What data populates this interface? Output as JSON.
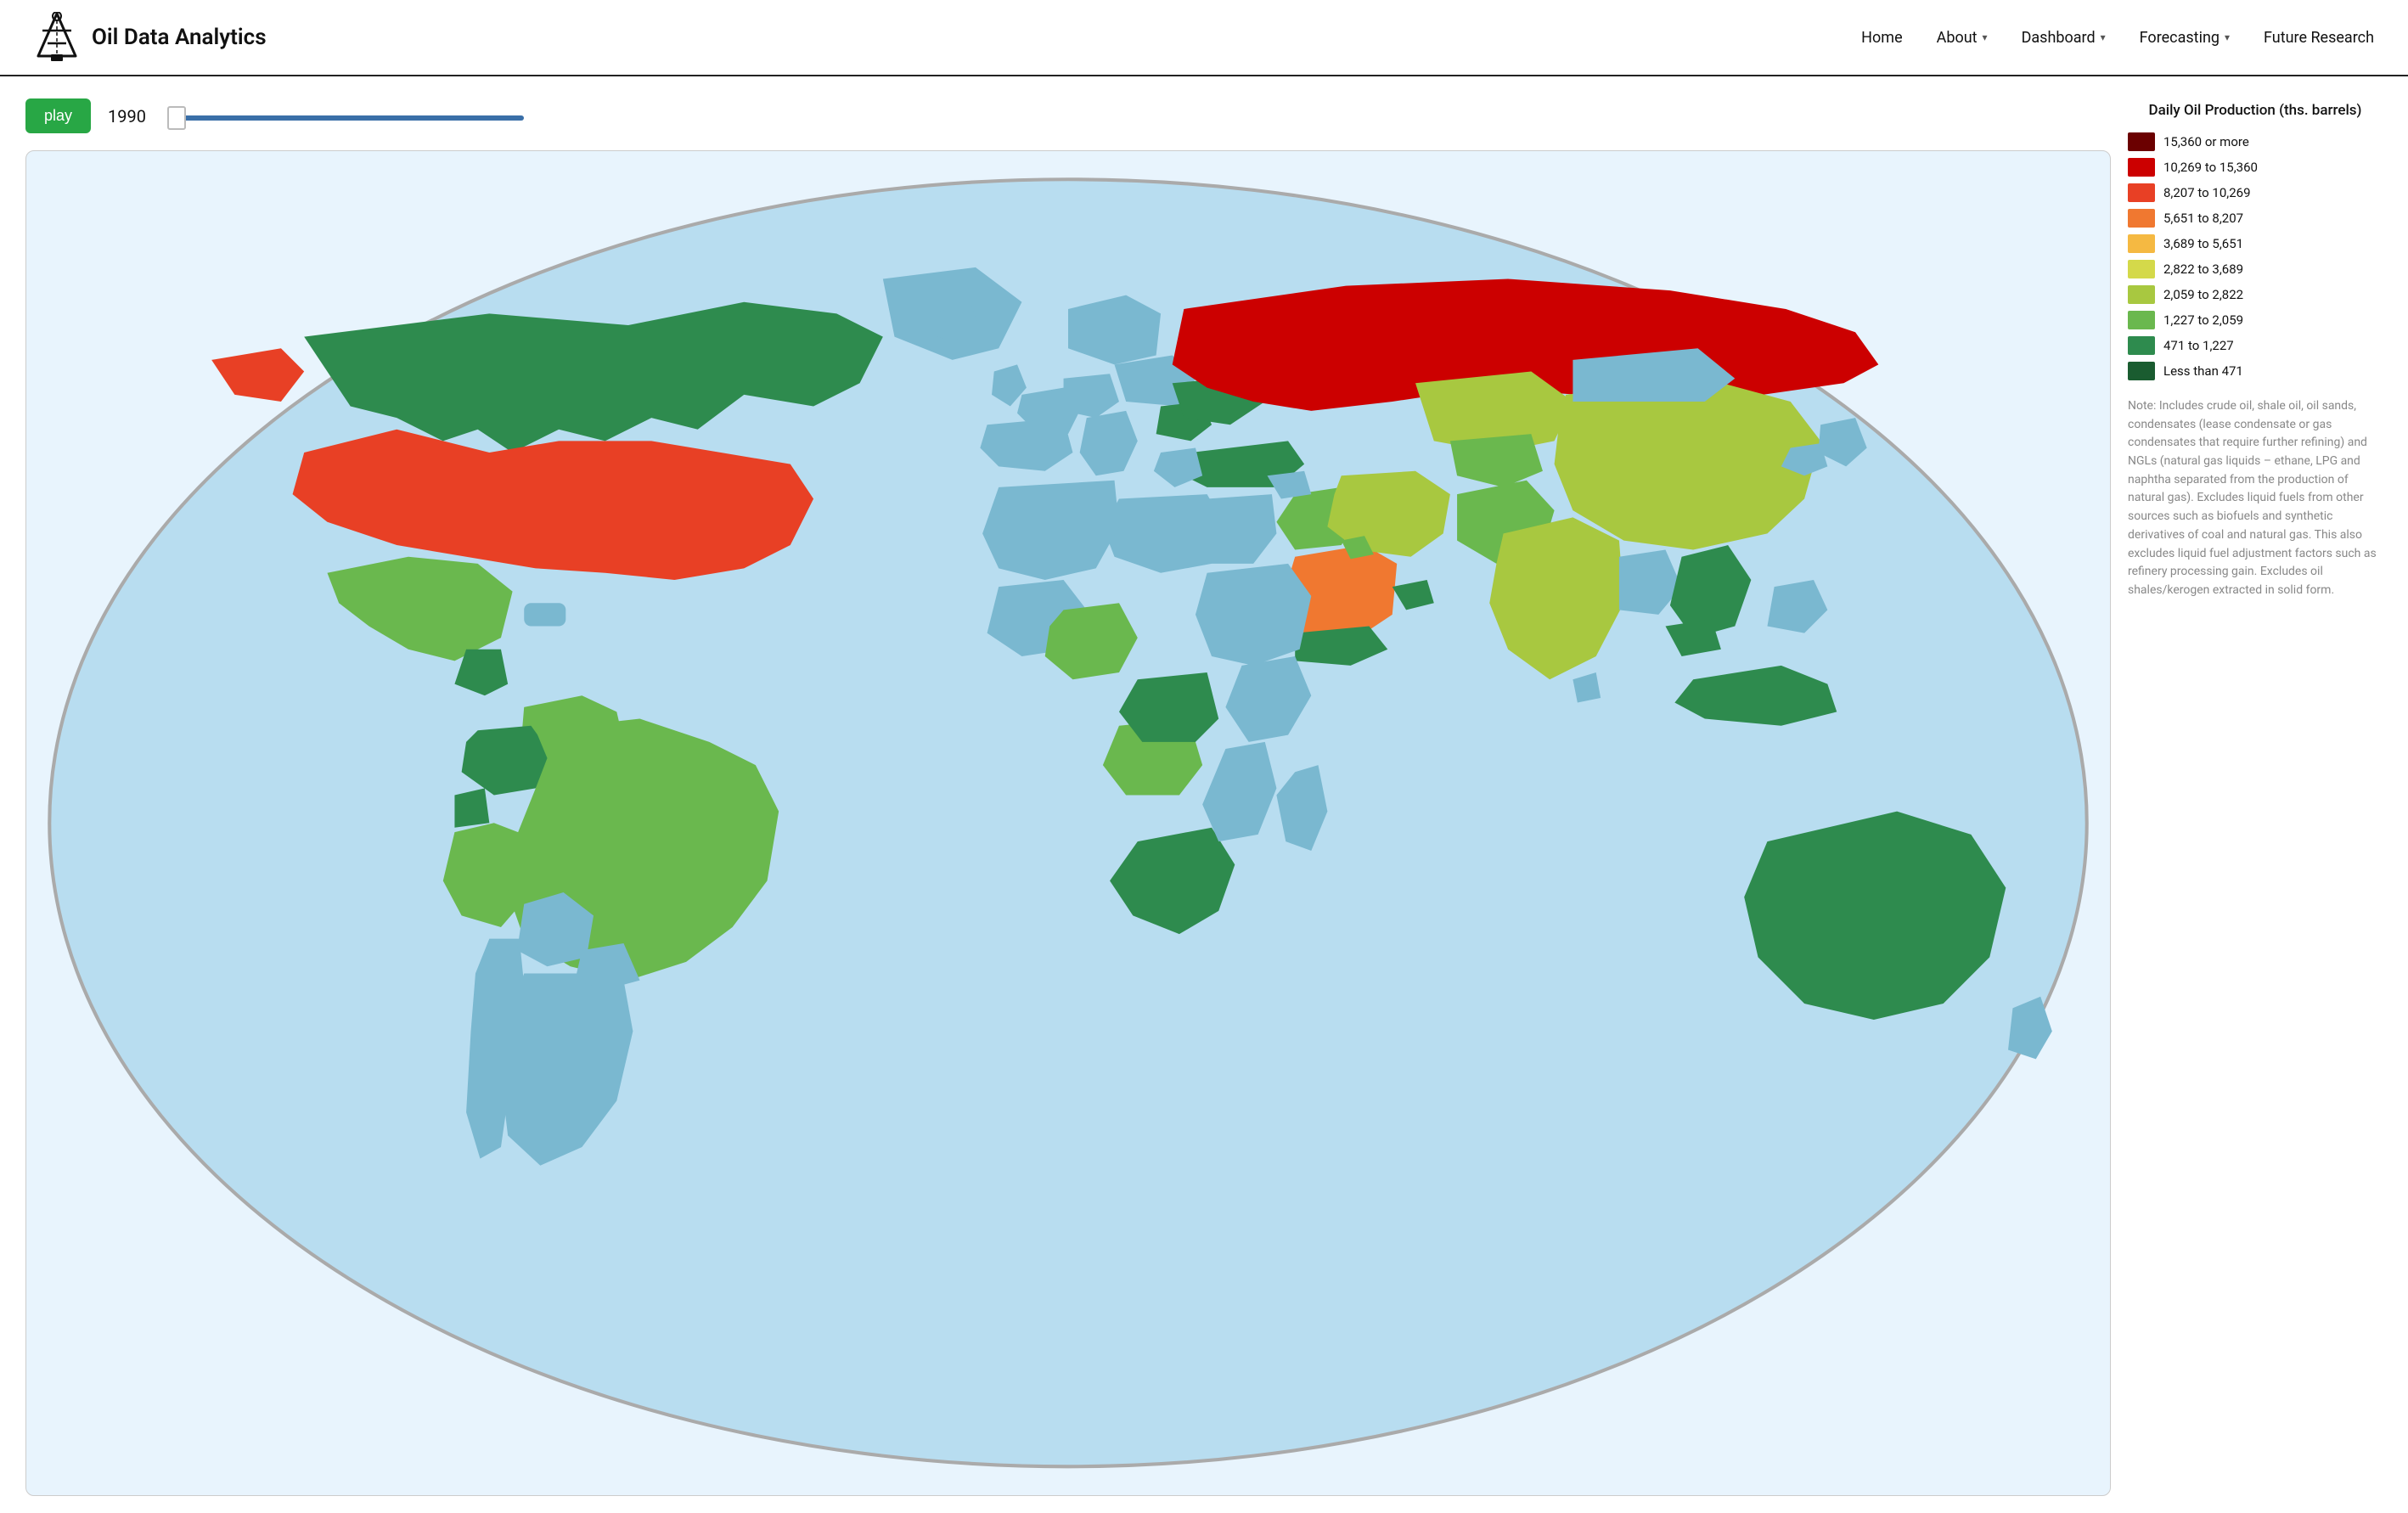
{
  "header": {
    "logo_text": "Oil Data Analytics",
    "nav_items": [
      {
        "id": "home",
        "label": "Home",
        "has_dropdown": false
      },
      {
        "id": "about",
        "label": "About",
        "has_dropdown": true
      },
      {
        "id": "dashboard",
        "label": "Dashboard",
        "has_dropdown": true
      },
      {
        "id": "forecasting",
        "label": "Forecasting",
        "has_dropdown": true
      },
      {
        "id": "future_research",
        "label": "Future Research",
        "has_dropdown": false
      }
    ]
  },
  "controls": {
    "play_label": "play",
    "year": "1990",
    "slider_min": 1990,
    "slider_max": 2020,
    "slider_value": 1990
  },
  "legend": {
    "title": "Daily Oil Production (ths. barrels)",
    "items": [
      {
        "color": "#6b0000",
        "label": "15,360 or more"
      },
      {
        "color": "#cc0000",
        "label": "10,269 to 15,360"
      },
      {
        "color": "#e84025",
        "label": "8,207 to 10,269"
      },
      {
        "color": "#f07830",
        "label": "5,651 to 8,207"
      },
      {
        "color": "#f5b942",
        "label": "3,689 to 5,651"
      },
      {
        "color": "#d4d94a",
        "label": "2,822 to 3,689"
      },
      {
        "color": "#a8c840",
        "label": "2,059 to 2,822"
      },
      {
        "color": "#6ab84e",
        "label": "1,227 to 2,059"
      },
      {
        "color": "#2e8b4e",
        "label": "471 to 1,227"
      },
      {
        "color": "#1a5c30",
        "label": "Less than 471"
      }
    ],
    "note": "Note: Includes crude oil, shale oil, oil sands, condensates (lease condensate or gas condensates that require further refining) and NGLs (natural gas liquids – ethane, LPG and naphtha separated from the production of natural gas). Excludes liquid fuels from other sources such as biofuels and synthetic derivatives of coal and natural gas. This also excludes liquid fuel adjustment factors such as refinery processing gain. Excludes oil shales/kerogen extracted in solid form."
  }
}
